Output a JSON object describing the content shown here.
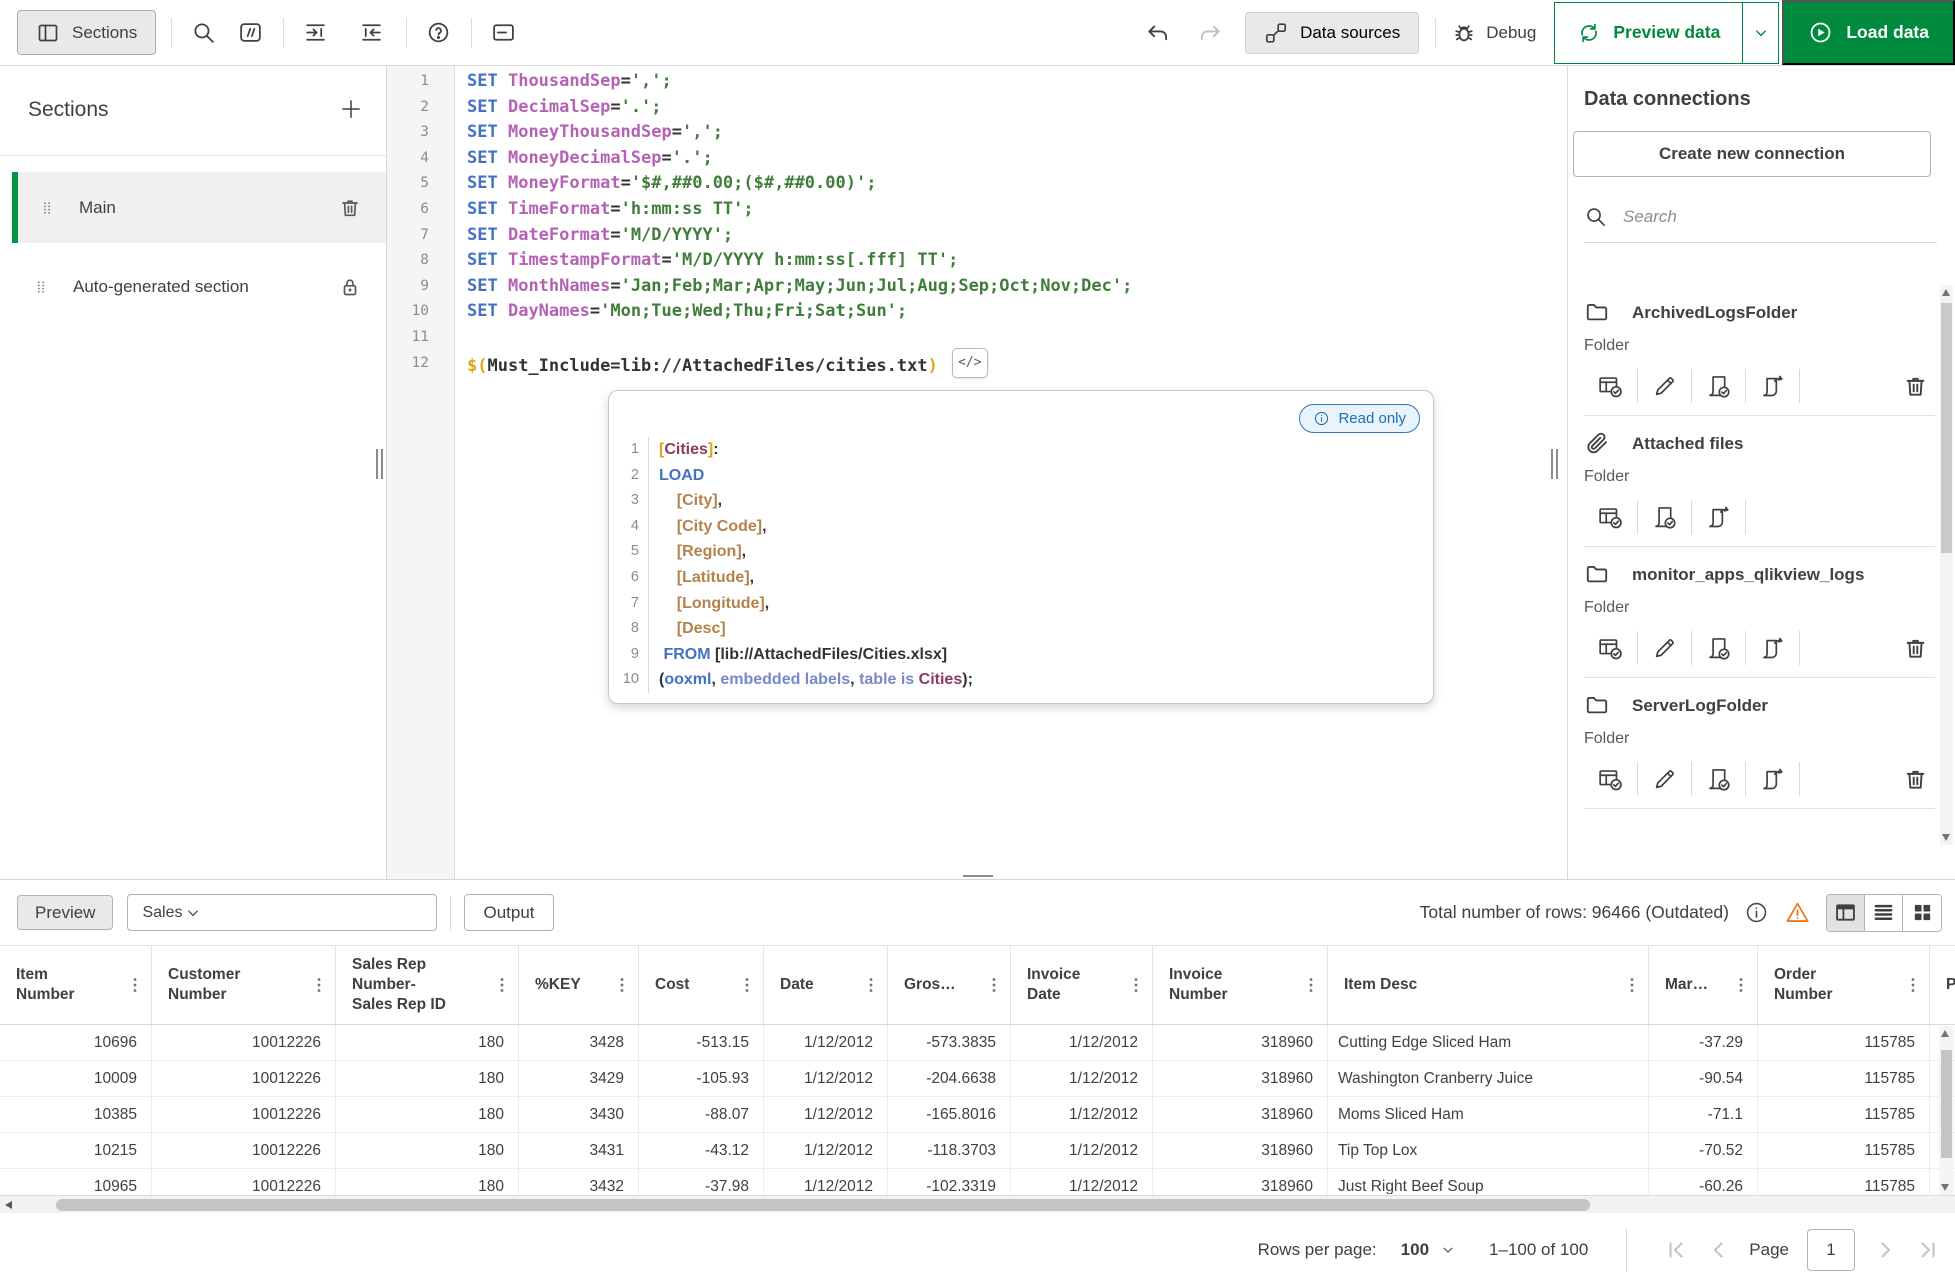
{
  "colors": {
    "qlik_green": "#008a3d",
    "selection_green": "#009845",
    "warning_orange": "#e77c22",
    "readonly_blue": "#1a6fb5",
    "code_keyword": "#4372c4",
    "code_keyword_light": "#7a87c9",
    "code_variable": "#b562b5",
    "code_string": "#417d3a",
    "code_field": "#b5824c",
    "code_table_name": "#8b3a62",
    "code_dollar_expansion": "#dfa518"
  },
  "topbar": {
    "sections_button": "Sections",
    "data_sources_button": "Data sources",
    "debug_button": "Debug",
    "preview_data_button": "Preview data",
    "load_data_button": "Load data",
    "left_icons": [
      "sections-panel-icon",
      "search-icon",
      "comment-icon",
      "indent-icon",
      "outdent-icon",
      "help-icon",
      "statement-icon"
    ],
    "right_icons": [
      "undo-icon",
      "redo-icon",
      "data-sources-icon",
      "debug-icon",
      "preview-data-icon",
      "caret-down-icon",
      "load-data-icon"
    ]
  },
  "sections_panel": {
    "title": "Sections",
    "items": [
      {
        "label": "Main",
        "selected": true,
        "action_icon": "delete-icon"
      },
      {
        "label": "Auto-generated section",
        "selected": false,
        "action_icon": "lock-icon"
      }
    ]
  },
  "script_editor": {
    "insert_button_label": "</>",
    "lines": [
      {
        "segs": [
          [
            "kw",
            "SET"
          ],
          [
            "pl",
            " "
          ],
          [
            "var",
            "ThousandSep"
          ],
          [
            "op",
            "="
          ],
          [
            "str",
            "',';"
          ]
        ]
      },
      {
        "segs": [
          [
            "kw",
            "SET"
          ],
          [
            "pl",
            " "
          ],
          [
            "var",
            "DecimalSep"
          ],
          [
            "op",
            "="
          ],
          [
            "str",
            "'.';"
          ]
        ]
      },
      {
        "segs": [
          [
            "kw",
            "SET"
          ],
          [
            "pl",
            " "
          ],
          [
            "var",
            "MoneyThousandSep"
          ],
          [
            "op",
            "="
          ],
          [
            "str",
            "',';"
          ]
        ]
      },
      {
        "segs": [
          [
            "kw",
            "SET"
          ],
          [
            "pl",
            " "
          ],
          [
            "var",
            "MoneyDecimalSep"
          ],
          [
            "op",
            "="
          ],
          [
            "str",
            "'.';"
          ]
        ]
      },
      {
        "segs": [
          [
            "kw",
            "SET"
          ],
          [
            "pl",
            " "
          ],
          [
            "var",
            "MoneyFormat"
          ],
          [
            "op",
            "="
          ],
          [
            "str",
            "'$#,##0.00;($#,##0.00)';"
          ]
        ]
      },
      {
        "segs": [
          [
            "kw",
            "SET"
          ],
          [
            "pl",
            " "
          ],
          [
            "var",
            "TimeFormat"
          ],
          [
            "op",
            "="
          ],
          [
            "str",
            "'h:mm:ss TT';"
          ]
        ]
      },
      {
        "segs": [
          [
            "kw",
            "SET"
          ],
          [
            "pl",
            " "
          ],
          [
            "var",
            "DateFormat"
          ],
          [
            "op",
            "="
          ],
          [
            "str",
            "'M/D/YYYY';"
          ]
        ]
      },
      {
        "segs": [
          [
            "kw",
            "SET"
          ],
          [
            "pl",
            " "
          ],
          [
            "var",
            "TimestampFormat"
          ],
          [
            "op",
            "="
          ],
          [
            "str",
            "'M/D/YYYY h:mm:ss[.fff] TT';"
          ]
        ]
      },
      {
        "segs": [
          [
            "kw",
            "SET"
          ],
          [
            "pl",
            " "
          ],
          [
            "var",
            "MonthNames"
          ],
          [
            "op",
            "="
          ],
          [
            "str",
            "'Jan;Feb;Mar;Apr;May;Jun;Jul;Aug;Sep;Oct;Nov;Dec';"
          ]
        ]
      },
      {
        "segs": [
          [
            "kw",
            "SET"
          ],
          [
            "pl",
            " "
          ],
          [
            "var",
            "DayNames"
          ],
          [
            "op",
            "="
          ],
          [
            "str",
            "'Mon;Tue;Wed;Thu;Fri;Sat;Sun';"
          ]
        ]
      },
      {
        "segs": []
      },
      {
        "segs": [
          [
            "gold",
            "$("
          ],
          [
            "pl",
            "Must_Include=lib://AttachedFiles/cities.txt"
          ],
          [
            "gold",
            ")"
          ]
        ],
        "insert_button": true
      }
    ]
  },
  "include_block": {
    "badge_label": "Read only",
    "lines": [
      {
        "segs": [
          [
            "gold",
            "["
          ],
          [
            "tbl",
            "Cities"
          ],
          [
            "gold",
            "]"
          ],
          [
            "pl",
            ":"
          ]
        ]
      },
      {
        "segs": [
          [
            "kw",
            "LOAD"
          ]
        ]
      },
      {
        "segs": [
          [
            "pl",
            "    "
          ],
          [
            "fld",
            "[City]"
          ],
          [
            "pl",
            ","
          ]
        ]
      },
      {
        "segs": [
          [
            "pl",
            "    "
          ],
          [
            "fld",
            "[City Code]"
          ],
          [
            "pl",
            ","
          ]
        ]
      },
      {
        "segs": [
          [
            "pl",
            "    "
          ],
          [
            "fld",
            "[Region]"
          ],
          [
            "pl",
            ","
          ]
        ]
      },
      {
        "segs": [
          [
            "pl",
            "    "
          ],
          [
            "fld",
            "[Latitude]"
          ],
          [
            "pl",
            ","
          ]
        ]
      },
      {
        "segs": [
          [
            "pl",
            "    "
          ],
          [
            "fld",
            "[Longitude]"
          ],
          [
            "pl",
            ","
          ]
        ]
      },
      {
        "segs": [
          [
            "pl",
            "    "
          ],
          [
            "fld",
            "[Desc]"
          ]
        ]
      },
      {
        "segs": [
          [
            "pl",
            " "
          ],
          [
            "kw",
            "FROM"
          ],
          [
            "pl",
            " [lib://AttachedFiles/Cities.xlsx]"
          ]
        ]
      },
      {
        "segs": [
          [
            "pl",
            "("
          ],
          [
            "kw",
            "ooxml"
          ],
          [
            "pl",
            ", "
          ],
          [
            "kw2",
            "embedded labels"
          ],
          [
            "pl",
            ", "
          ],
          [
            "kw2",
            "table is"
          ],
          [
            "pl",
            " "
          ],
          [
            "tbl",
            "Cities"
          ],
          [
            "pl",
            ");"
          ]
        ]
      }
    ]
  },
  "connections_panel": {
    "title": "Data connections",
    "create_button": "Create new connection",
    "search_placeholder": "Search",
    "items": [
      {
        "name": "ArchivedLogsFolder",
        "subtitle": "Folder",
        "icon": "folder-icon",
        "actions": [
          "select-data",
          "edit-connection",
          "insert-connection",
          "insert-string"
        ],
        "deletable": true
      },
      {
        "name": "Attached files",
        "subtitle": "Folder",
        "icon": "paperclip-icon",
        "actions": [
          "select-data",
          "insert-connection",
          "insert-string"
        ],
        "deletable": false
      },
      {
        "name": "monitor_apps_qlikview_logs",
        "subtitle": "Folder",
        "icon": "folder-icon",
        "actions": [
          "select-data",
          "edit-connection",
          "insert-connection",
          "insert-string"
        ],
        "deletable": true
      },
      {
        "name": "ServerLogFolder",
        "subtitle": "Folder",
        "icon": "folder-icon",
        "actions": [
          "select-data",
          "edit-connection",
          "insert-connection",
          "insert-string"
        ],
        "deletable": true
      }
    ]
  },
  "preview_panel": {
    "preview_button": "Preview",
    "table_selector_value": "Sales",
    "output_button": "Output",
    "total_rows_text": "Total number of rows: 96466 (Outdated)",
    "view_icons": [
      "table-view-icon",
      "list-view-icon",
      "grid-view-icon"
    ],
    "table": {
      "columns": [
        "Item\nNumber",
        "Customer\nNumber",
        "Sales Rep\nNumber-\nSales Rep ID",
        "%KEY",
        "Cost",
        "Date",
        "Gros…",
        "Invoice\nDate",
        "Invoice\nNumber",
        "Item Desc",
        "Mar…",
        "Order\nNumber",
        "P"
      ],
      "rows": [
        [
          "10696",
          "10012226",
          "180",
          "3428",
          "-513.15",
          "1/12/2012",
          "-573.3835",
          "1/12/2012",
          "318960",
          "Cutting Edge Sliced Ham",
          "-37.29",
          "115785",
          ""
        ],
        [
          "10009",
          "10012226",
          "180",
          "3429",
          "-105.93",
          "1/12/2012",
          "-204.6638",
          "1/12/2012",
          "318960",
          "Washington Cranberry Juice",
          "-90.54",
          "115785",
          ""
        ],
        [
          "10385",
          "10012226",
          "180",
          "3430",
          "-88.07",
          "1/12/2012",
          "-165.8016",
          "1/12/2012",
          "318960",
          "Moms Sliced Ham",
          "-71.1",
          "115785",
          ""
        ],
        [
          "10215",
          "10012226",
          "180",
          "3431",
          "-43.12",
          "1/12/2012",
          "-118.3703",
          "1/12/2012",
          "318960",
          "Tip Top Lox",
          "-70.52",
          "115785",
          ""
        ],
        [
          "10965",
          "10012226",
          "180",
          "3432",
          "-37.98",
          "1/12/2012",
          "-102.3319",
          "1/12/2012",
          "318960",
          "Just Right Beef Soup",
          "-60.26",
          "115785",
          ""
        ]
      ]
    },
    "pagination": {
      "rows_per_page_label": "Rows per page:",
      "rows_per_page_value": "100",
      "range_text": "1–100 of 100",
      "page_label": "Page",
      "page_value": "1"
    }
  }
}
